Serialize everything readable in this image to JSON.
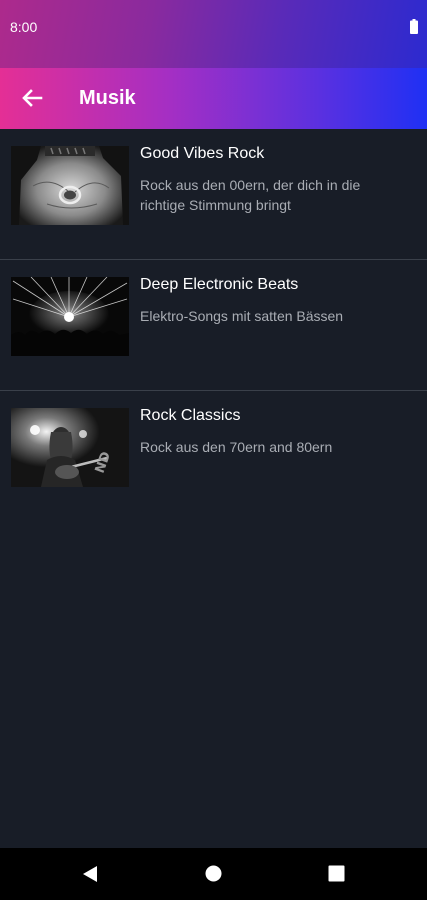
{
  "status_bar": {
    "time": "8:00"
  },
  "app_bar": {
    "title": "Musik",
    "back_icon": "arrow-back-icon"
  },
  "playlists": [
    {
      "title": "Good Vibes Rock",
      "description": "Rock aus den 00ern, der dich in die richtige Stimmung bringt",
      "image": "hand-with-ring-photo"
    },
    {
      "title": "Deep Electronic Beats",
      "description": "Elektro-Songs mit satten Bässen",
      "image": "concert-lights-photo"
    },
    {
      "title": "Rock Classics",
      "description": "Rock aus den 70ern and 80ern",
      "image": "guitarist-on-stage-photo"
    }
  ],
  "nav_bar": {
    "icons": [
      "back-triangle-icon",
      "home-circle-icon",
      "recents-square-icon"
    ]
  },
  "colors": {
    "background": "#181d27",
    "divider": "#3a404a",
    "secondary_text": "#a9adb4",
    "accent_start": "#e42f95",
    "accent_end": "#1f30f4"
  }
}
